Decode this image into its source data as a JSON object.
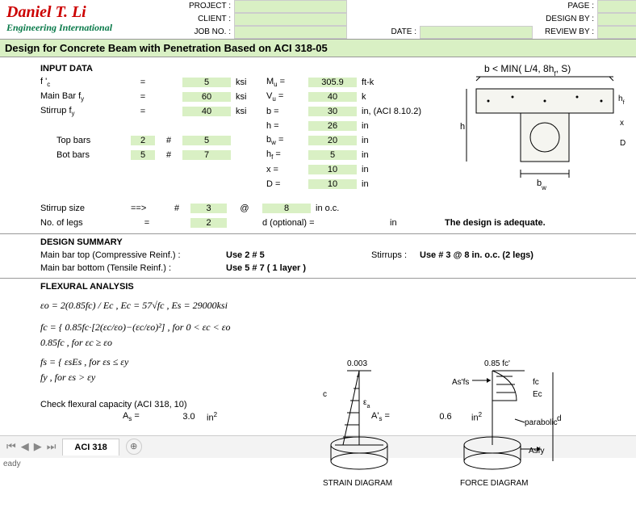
{
  "logo": {
    "name": "Daniel T. Li",
    "sub": "Engineering International"
  },
  "header": {
    "project_lbl": "PROJECT :",
    "client_lbl": "CLIENT :",
    "jobno_lbl": "JOB NO. :",
    "date_lbl": "DATE :",
    "page_lbl": "PAGE :",
    "designby_lbl": "DESIGN BY :",
    "reviewby_lbl": "REVIEW BY :"
  },
  "title": "Design for Concrete Beam with  Penetration Based on ACI 318-05",
  "input": {
    "head": "INPUT DATA",
    "fc_lbl": "f 'c",
    "fc_eq": "=",
    "fc_val": "5",
    "fc_unit": "ksi",
    "mu_lbl": "Mu =",
    "mu_val": "305.9",
    "mu_unit": "ft-k",
    "fy_lbl": "Main Bar fy",
    "fy_eq": "=",
    "fy_val": "60",
    "fy_unit": "ksi",
    "vu_lbl": "Vu =",
    "vu_val": "40",
    "vu_unit": "k",
    "sfy_lbl": "Stirrup fy",
    "sfy_eq": "=",
    "sfy_val": "40",
    "sfy_unit": "ksi",
    "b_lbl": "b =",
    "b_val": "30",
    "b_unit": "in, (ACI 8.10.2)",
    "h_lbl": "h =",
    "h_val": "26",
    "h_unit": "in",
    "top_lbl": "Top bars",
    "top_n": "2",
    "top_hash": "#",
    "top_size": "5",
    "bw_lbl": "bw =",
    "bw_val": "20",
    "bw_unit": "in",
    "bot_lbl": "Bot bars",
    "bot_n": "5",
    "bot_hash": "#",
    "bot_size": "7",
    "hf_lbl": "hf =",
    "hf_val": "5",
    "hf_unit": "in",
    "x_lbl": "x =",
    "x_val": "10",
    "x_unit": "in",
    "D_lbl": "D =",
    "D_val": "10",
    "D_unit": "in",
    "stir_lbl": "Stirrup size",
    "stir_arrow": "==>",
    "stir_hash": "#",
    "stir_size": "3",
    "stir_at": "@",
    "stir_sp": "8",
    "stir_sp_unit": "in o.c.",
    "legs_lbl": "No. of legs",
    "legs_eq": "=",
    "legs_val": "2",
    "dopt_lbl": "d (optional) =",
    "dopt_unit": "in",
    "adequate": "The design is adequate."
  },
  "diagram1": {
    "note": "b < MIN( L/4, 8hf, S)",
    "bw": "bw",
    "hf": "hf",
    "h": "h",
    "x": "x",
    "D": "D"
  },
  "summary": {
    "head": "DESIGN SUMMARY",
    "top_lbl": "Main bar top (Compressive Reinf.) :",
    "top_val": "Use  2 # 5",
    "stir_lbl": "Stirrups :",
    "stir_val": "Use # 3 @ 8 in. o.c.  (2 legs)",
    "bot_lbl": "Main bar bottom (Tensile Reinf.) :",
    "bot_val": "Use  5 # 7 ( 1 layer )"
  },
  "flex": {
    "head": "FLEXURAL ANALYSIS",
    "f1": "εo = 2(0.85fc) / Ec ,   Ec = 57√fc ,   Es = 29000ksi",
    "f2": "fc = { 0.85fc·[2(εc/εo)−(εc/εo)²] ,  for  0 < εc < εo",
    "f2b": "        0.85fc ,  for  εc ≥ εo",
    "f3": "fs = { εsEs ,  for  εs ≤ εy",
    "f3b": "        fy ,  for  εs > εy",
    "check": "Check flexural capacity (ACI 318, 10)",
    "as_lbl": "As =",
    "as_val": "3.0",
    "as_unit": "in²",
    "asp_lbl": "A's =",
    "asp_val": "0.6",
    "asp_unit": "in²"
  },
  "diag2": {
    "top003": "0.003",
    "top085": "0.85 fc'",
    "asfs": "As'fs",
    "fc": "fc",
    "ec": "Ec",
    "para": "parabolic",
    "asfy": "Asfy",
    "strain": "STRAIN  DIAGRAM",
    "force": "FORCE  DIAGRAM",
    "c": "c",
    "ea": "εa",
    "d": "d"
  },
  "tabs": {
    "active": "ACI 318"
  },
  "status": "eady"
}
